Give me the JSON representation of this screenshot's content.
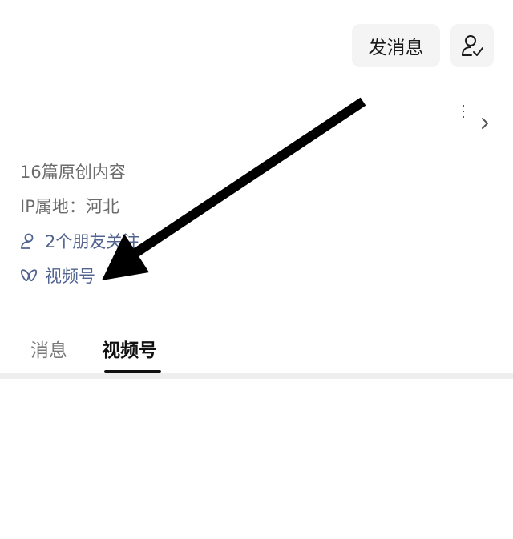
{
  "header": {
    "message_button_label": "发消息",
    "follow_icon": "person-check-icon",
    "more_icon": "more-vertical-icon",
    "chevron_icon": "chevron-right-icon"
  },
  "profile": {
    "original_content": "16篇原创内容",
    "ip_location": "IP属地：河北",
    "friends_following": "2个朋友关注",
    "channels_label": "视频号"
  },
  "tabs": [
    {
      "label": "消息",
      "active": false
    },
    {
      "label": "视频号",
      "active": true
    }
  ],
  "colors": {
    "link": "#51638e",
    "muted_text": "#6b6b6b",
    "button_bg": "#f4f4f4",
    "annotation_arrow": "#000000"
  }
}
